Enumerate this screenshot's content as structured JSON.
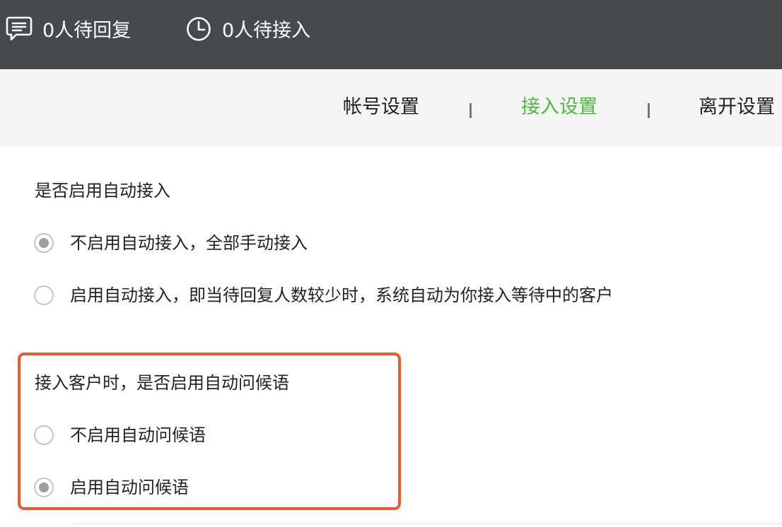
{
  "topbar": {
    "pending_reply": {
      "icon": "message-icon",
      "label": "0人待回复"
    },
    "pending_access": {
      "icon": "clock-icon",
      "label": "0人待接入"
    }
  },
  "tabs": [
    {
      "label": "帐号设置",
      "active": false
    },
    {
      "label": "接入设置",
      "active": true
    },
    {
      "label": "离开设置",
      "active": false
    }
  ],
  "auto_access": {
    "title": "是否启用自动接入",
    "options": [
      {
        "label": "不启用自动接入，全部手动接入",
        "checked": true
      },
      {
        "label": "启用自动接入，即当待回复人数较少时，系统自动为你接入等待中的客户",
        "checked": false
      }
    ]
  },
  "auto_greeting": {
    "title": "接入客户时，是否启用自动问候语",
    "options": [
      {
        "label": "不启用自动问候语",
        "checked": false
      },
      {
        "label": "启用自动问候语",
        "checked": true
      }
    ]
  },
  "colors": {
    "topbar_bg": "#464a4d",
    "tabbar_bg": "#f5f5f5",
    "active_tab": "#4cbb3c",
    "highlight_border": "#f05a2b"
  }
}
